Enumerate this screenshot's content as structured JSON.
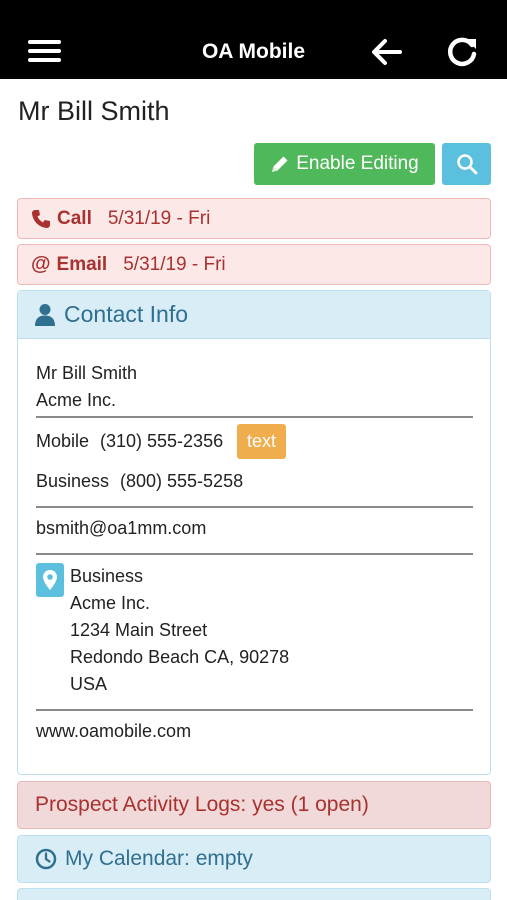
{
  "app": {
    "title": "OA Mobile"
  },
  "contact": {
    "heading": "Mr Bill Smith"
  },
  "toolbar": {
    "enable_editing_label": "Enable Editing"
  },
  "activities": [
    {
      "kind": "Call",
      "date": "5/31/19 - Fri"
    },
    {
      "kind": "Email",
      "date": "5/31/19 - Fri"
    }
  ],
  "contact_info": {
    "header": "Contact Info",
    "name": "Mr Bill Smith",
    "company": "Acme Inc.",
    "mobile_label": "Mobile",
    "mobile_number": "(310) 555-2356",
    "text_badge": "text",
    "business_label": "Business",
    "business_number": "(800) 555-5258",
    "email": "bsmith@oa1mm.com",
    "address": {
      "label": "Business",
      "line1": "Acme Inc.",
      "line2": "1234 Main Street",
      "line3": "Redondo Beach CA, 90278",
      "line4": "USA"
    },
    "website": "www.oamobile.com"
  },
  "prospect_logs": {
    "label": "Prospect Activity Logs: yes (1 open)"
  },
  "calendar": {
    "label": "My Calendar: empty"
  },
  "colors": {
    "header_bg": "#000000",
    "success": "#4fb85a",
    "info": "#5bc0de",
    "warning": "#f0ad4e",
    "danger_text": "#a8322f",
    "info_text": "#2f6f8f"
  },
  "icons": {
    "menu": "hamburger-icon",
    "back": "arrow-left-icon",
    "refresh": "refresh-icon",
    "edit": "pencil-icon",
    "search": "search-icon",
    "call": "phone-icon",
    "email": "at-icon",
    "contact": "user-icon",
    "address": "map-marker-icon",
    "calendar": "clock-icon"
  }
}
